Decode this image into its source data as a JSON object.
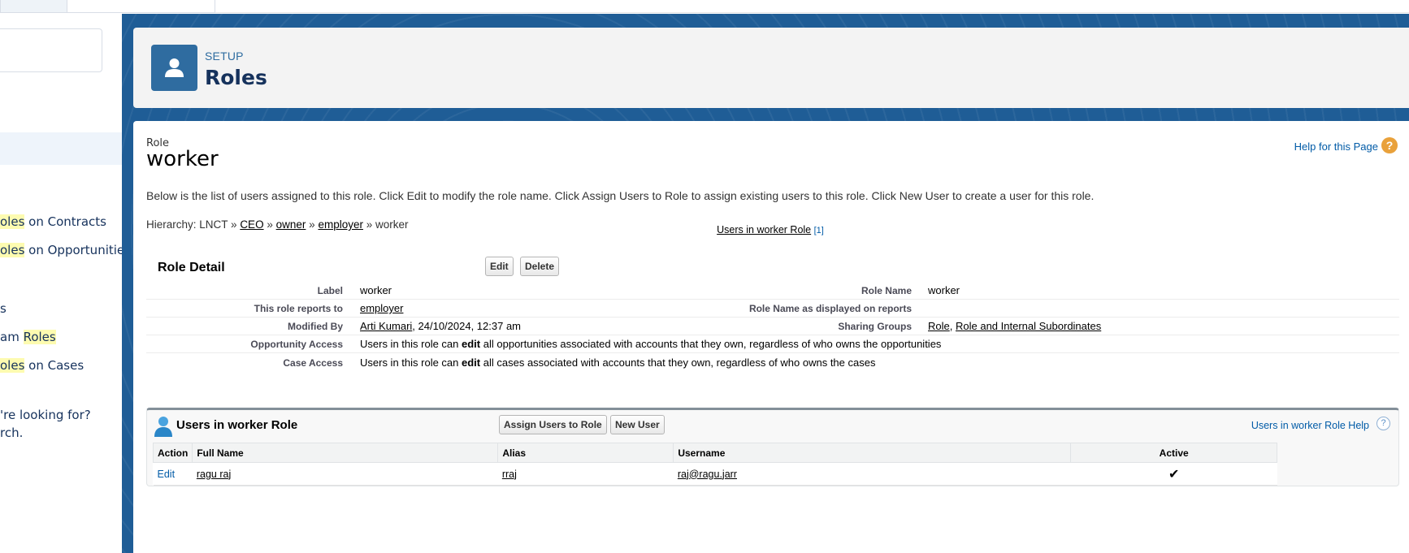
{
  "sidebar": {
    "items": [
      {
        "prefix": "",
        "highlight": "oles",
        "suffix": " on Contracts"
      },
      {
        "prefix": "",
        "highlight": "oles",
        "suffix": " on Opportunities"
      },
      {
        "prefix": "s",
        "highlight": "",
        "suffix": ""
      },
      {
        "prefix": "am ",
        "highlight": "Roles",
        "suffix": ""
      },
      {
        "prefix": "",
        "highlight": "oles",
        "suffix": " on Cases"
      }
    ],
    "help_line1": "'re looking for?",
    "help_line2": "rch."
  },
  "header": {
    "eyebrow": "SETUP",
    "title": "Roles",
    "icon": "user-icon"
  },
  "role": {
    "type_label": "Role",
    "name": "worker",
    "help_link": "Help for this Page",
    "help_icon_glyph": "?",
    "intro": "Below is the list of users assigned to this role. Click Edit to modify the role name. Click Assign Users to Role to assign existing users to this role. Click New User to create a user for this role.",
    "hierarchy": {
      "prefix": "Hierarchy: LNCT »",
      "links": [
        "CEO",
        "owner",
        "employer"
      ],
      "sep": "»",
      "current": "worker"
    },
    "jump": {
      "label": "Users in worker Role",
      "count": "[1]"
    }
  },
  "detail": {
    "title": "Role Detail",
    "edit_label": "Edit",
    "delete_label": "Delete",
    "label_label": "Label",
    "label_value": "worker",
    "role_name_label": "Role Name",
    "role_name_value": "worker",
    "reports_to_label": "This role reports to",
    "reports_to_value": "employer",
    "display_label": "Role Name as displayed on reports",
    "display_value": "",
    "modified_label": "Modified By",
    "modified_user": "Arti Kumari",
    "modified_date": ", 24/10/2024, 12:37 am",
    "sharing_label": "Sharing Groups",
    "sharing_link1": "Role",
    "sharing_sep": ",",
    "sharing_link2": "Role and Internal Subordinates",
    "opp_label": "Opportunity Access",
    "opp_pre": "Users in this role can",
    "opp_bold": "edit",
    "opp_post": "all opportunities associated with accounts that they own, regardless of who owns the opportunities",
    "case_label": "Case Access",
    "case_pre": "Users in this role can",
    "case_bold": "edit",
    "case_post": "all cases associated with accounts that they own, regardless of who owns the cases"
  },
  "related": {
    "title": "Users in worker Role",
    "assign_label": "Assign Users to Role",
    "new_user_label": "New User",
    "help_label": "Users in worker Role Help",
    "help_icon_glyph": "?",
    "columns": [
      "Action",
      "Full Name",
      "Alias",
      "Username",
      "Active"
    ],
    "rows": [
      {
        "action": "Edit",
        "full_name": "ragu raj",
        "alias": "rraj",
        "username": "raj@ragu.jarr",
        "active": "✔"
      }
    ]
  },
  "colors": {
    "brand_blue": "#2f6ca0",
    "backdrop": "#1f5d96",
    "link": "#015ba7",
    "highlight": "#fdfbb0"
  }
}
